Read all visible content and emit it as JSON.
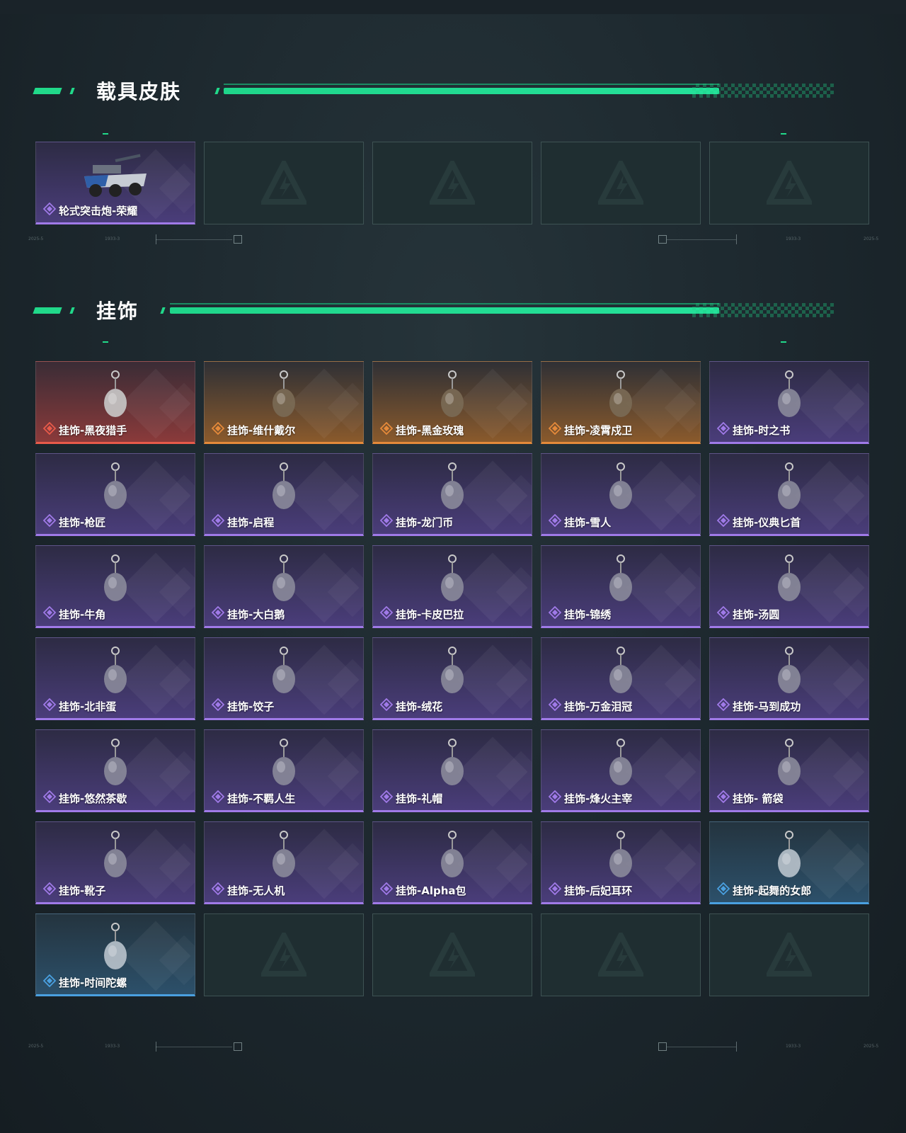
{
  "sections": {
    "vehicle": {
      "title": "载具皮肤"
    },
    "charms": {
      "title": "挂饰"
    }
  },
  "vehicle_items": [
    {
      "name": "轮式突击炮-荣耀",
      "rarity": "purple",
      "icon": "armored-vehicle-icon"
    }
  ],
  "charm_items": [
    {
      "name": "挂饰-黑夜猎手",
      "rarity": "red",
      "icon": "wolf-charm-icon"
    },
    {
      "name": "挂饰-维什戴尔",
      "rarity": "orange",
      "icon": "card-charm-icon"
    },
    {
      "name": "挂饰-黑金玫瑰",
      "rarity": "orange",
      "icon": "rose-charm-icon"
    },
    {
      "name": "挂饰-凌霄戍卫",
      "rarity": "orange",
      "icon": "guard-charm-icon"
    },
    {
      "name": "挂饰-时之书",
      "rarity": "purple",
      "icon": "book-charm-icon"
    },
    {
      "name": "挂饰-枪匠",
      "rarity": "purple",
      "icon": "gunsmith-charm-icon"
    },
    {
      "name": "挂饰-启程",
      "rarity": "purple",
      "icon": "badge-charm-icon"
    },
    {
      "name": "挂饰-龙门币",
      "rarity": "purple",
      "icon": "coin-charm-icon"
    },
    {
      "name": "挂饰-雪人",
      "rarity": "purple",
      "icon": "snowman-charm-icon"
    },
    {
      "name": "挂饰-仪典匕首",
      "rarity": "purple",
      "icon": "dagger-charm-icon"
    },
    {
      "name": "挂饰-牛角",
      "rarity": "purple",
      "icon": "horns-charm-icon"
    },
    {
      "name": "挂饰-大白鹅",
      "rarity": "purple",
      "icon": "goose-charm-icon"
    },
    {
      "name": "挂饰-卡皮巴拉",
      "rarity": "purple",
      "icon": "capybara-charm-icon"
    },
    {
      "name": "挂饰-锦绣",
      "rarity": "purple",
      "icon": "butterfly-charm-icon"
    },
    {
      "name": "挂饰-汤圆",
      "rarity": "purple",
      "icon": "dumpling-bowl-charm-icon"
    },
    {
      "name": "挂饰-北非蛋",
      "rarity": "purple",
      "icon": "egg-pan-charm-icon"
    },
    {
      "name": "挂饰-饺子",
      "rarity": "purple",
      "icon": "dumplings-charm-icon"
    },
    {
      "name": "挂饰-绒花",
      "rarity": "purple",
      "icon": "flower-charm-icon"
    },
    {
      "name": "挂饰-万金泪冠",
      "rarity": "purple",
      "icon": "crown-charm-icon"
    },
    {
      "name": "挂饰-马到成功",
      "rarity": "purple",
      "icon": "horse-charm-icon"
    },
    {
      "name": "挂饰-悠然茶歇",
      "rarity": "purple",
      "icon": "cupcake-charm-icon"
    },
    {
      "name": "挂饰-不羁人生",
      "rarity": "purple",
      "icon": "sneaker-charm-icon"
    },
    {
      "name": "挂饰-礼帽",
      "rarity": "purple",
      "icon": "hat-charm-icon"
    },
    {
      "name": "挂饰-烽火主宰",
      "rarity": "purple",
      "icon": "graffiti-charm-icon"
    },
    {
      "name": "挂饰- 箭袋",
      "rarity": "purple",
      "icon": "quiver-charm-icon"
    },
    {
      "name": "挂饰-靴子",
      "rarity": "purple",
      "icon": "boot-charm-icon"
    },
    {
      "name": "挂饰-无人机",
      "rarity": "purple",
      "icon": "drone-charm-icon"
    },
    {
      "name": "挂饰-Alpha包",
      "rarity": "purple",
      "icon": "bag-charm-icon"
    },
    {
      "name": "挂饰-后妃耳环",
      "rarity": "purple",
      "icon": "earring-charm-icon"
    },
    {
      "name": "挂饰-起舞的女郎",
      "rarity": "blue",
      "icon": "dancer-charm-icon"
    },
    {
      "name": "挂饰-时间陀螺",
      "rarity": "blue",
      "icon": "spinning-top-charm-icon"
    }
  ],
  "colors": {
    "accent": "#21d98a",
    "purple": "#a07ae8",
    "red": "#e85a4a",
    "orange": "#e58a3a",
    "blue": "#4aa0e0"
  }
}
